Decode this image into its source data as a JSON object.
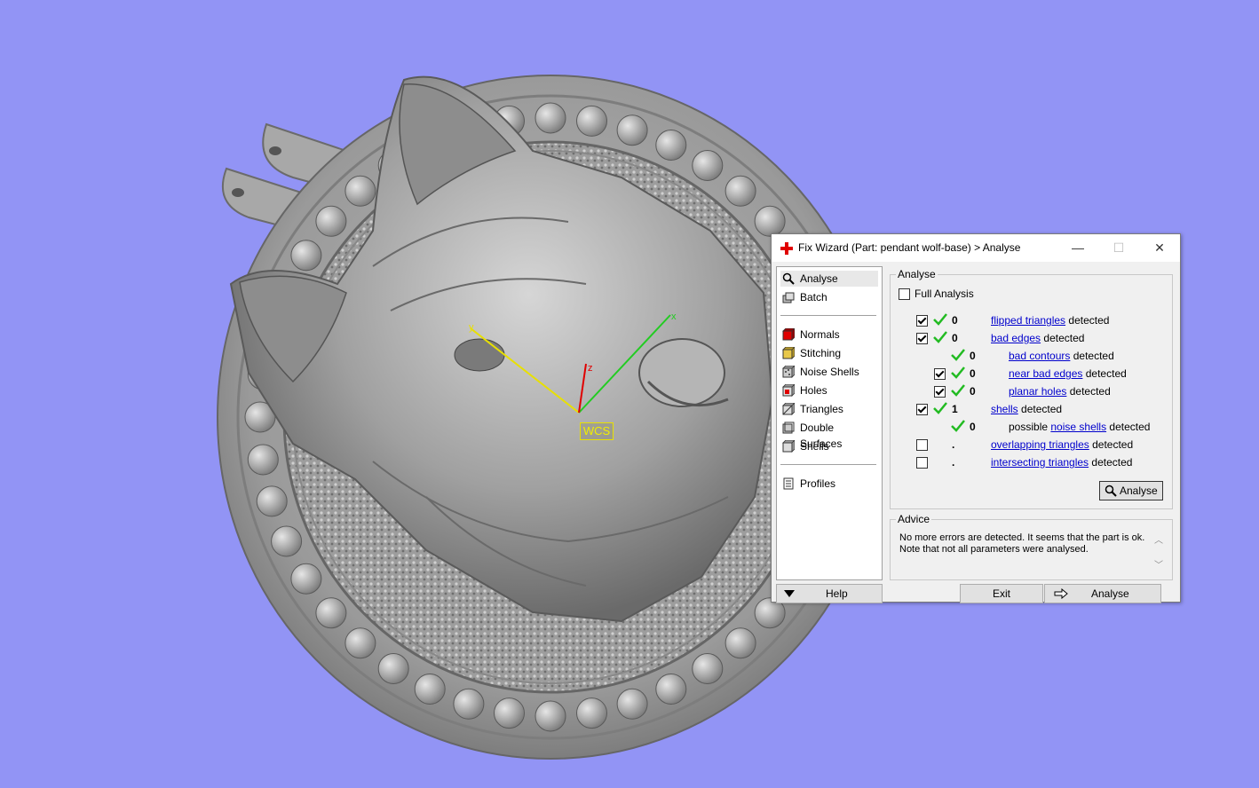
{
  "viewport": {
    "background_color": "#9294f5",
    "wcs_label": "WCS",
    "axis_labels": {
      "x": "x",
      "y": "y",
      "z": "z"
    },
    "axis_colors": {
      "x": "#22cc22",
      "y": "#e8e000",
      "z": "#e00000"
    }
  },
  "dialog": {
    "title": "Fix Wizard (Part: pendant wolf-base) > Analyse",
    "title_icon": "red-cross-icon",
    "controls": {
      "minimize": "—",
      "maximize": "☐",
      "close": "✕"
    },
    "nav": {
      "top_items": [
        {
          "label": "Analyse",
          "icon": "magnifier-icon",
          "selected": true
        },
        {
          "label": "Batch",
          "icon": "batch-icon",
          "selected": false
        }
      ],
      "tools": [
        {
          "label": "Normals",
          "icon": "normals-cube-icon"
        },
        {
          "label": "Stitching",
          "icon": "stitching-cube-icon"
        },
        {
          "label": "Noise Shells",
          "icon": "noise-shells-icon"
        },
        {
          "label": "Holes",
          "icon": "holes-cube-icon"
        },
        {
          "label": "Triangles",
          "icon": "triangles-cube-icon"
        },
        {
          "label": "Double Surfaces",
          "icon": "double-surfaces-icon"
        },
        {
          "label": "Shells",
          "icon": "shells-cube-icon"
        }
      ],
      "bottom_items": [
        {
          "label": "Profiles",
          "icon": "profiles-icon"
        }
      ]
    },
    "analyse_group": {
      "title": "Analyse",
      "full_analysis_label": "Full Analysis",
      "full_analysis_checked": false,
      "rows": [
        {
          "checkbox": true,
          "checked": true,
          "ok": true,
          "value": "0",
          "prefix": "",
          "link": "flipped triangles",
          "suffix": "detected",
          "indent": 0
        },
        {
          "checkbox": true,
          "checked": true,
          "ok": true,
          "value": "0",
          "prefix": "",
          "link": "bad edges",
          "suffix": "detected",
          "indent": 0
        },
        {
          "checkbox": false,
          "checked": false,
          "ok": true,
          "value": "0",
          "prefix": "",
          "link": "bad contours",
          "suffix": "detected",
          "indent": 1
        },
        {
          "checkbox": true,
          "checked": true,
          "ok": true,
          "value": "0",
          "prefix": "",
          "link": "near bad edges",
          "suffix": "detected",
          "indent": 1
        },
        {
          "checkbox": true,
          "checked": true,
          "ok": true,
          "value": "0",
          "prefix": "",
          "link": "planar holes",
          "suffix": "detected",
          "indent": 1
        },
        {
          "checkbox": true,
          "checked": true,
          "ok": true,
          "value": "1",
          "prefix": "",
          "link": "shells",
          "suffix": "detected",
          "indent": 0
        },
        {
          "checkbox": false,
          "checked": false,
          "ok": true,
          "value": "0",
          "prefix": "possible",
          "link": "noise shells",
          "suffix": "detected",
          "indent": 1
        },
        {
          "checkbox": true,
          "checked": false,
          "ok": false,
          "value": ".",
          "prefix": "",
          "link": "overlapping triangles",
          "suffix": "detected",
          "indent": 0
        },
        {
          "checkbox": true,
          "checked": false,
          "ok": false,
          "value": ".",
          "prefix": "",
          "link": "intersecting triangles",
          "suffix": "detected",
          "indent": 0
        }
      ],
      "analyse_button": "Analyse"
    },
    "advice_group": {
      "title": "Advice",
      "text": "No more errors are detected. It seems that the part is ok. Note that not all parameters were analysed."
    },
    "footer": {
      "help": "Help",
      "exit": "Exit",
      "analyse": "Analyse"
    }
  }
}
